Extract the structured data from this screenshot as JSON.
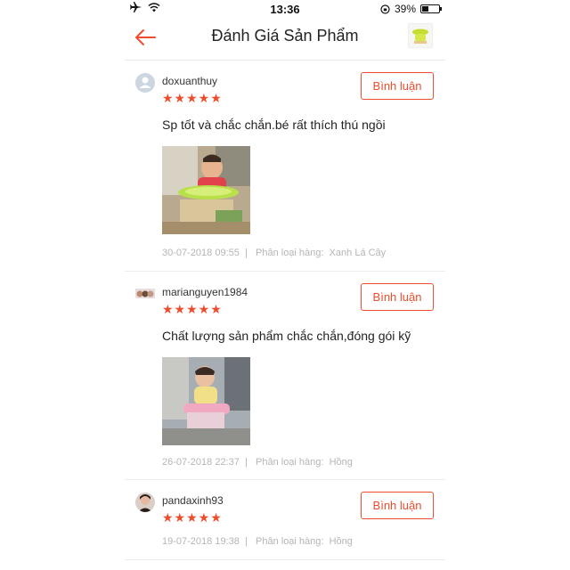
{
  "status_bar": {
    "time": "13:36",
    "battery": "39%",
    "battery_level": 0.39
  },
  "header": {
    "title": "Đánh Giá Sản Phẩm"
  },
  "reviews": [
    {
      "username": "doxuanthuy",
      "rating": 5,
      "stars": "★★★★★",
      "comment_label": "Bình luận",
      "text": "Sp tốt và chắc chắn.bé rất thích thú ngồi",
      "date": "30-07-2018 09:55",
      "variant_label": "Phân loại hàng:",
      "variant": "Xanh Lá Cây"
    },
    {
      "username": "marianguyen1984",
      "rating": 5,
      "stars": "★★★★★",
      "comment_label": "Bình luận",
      "text": "Chất lượng sản phẩm chắc chắn,đóng gói kỹ",
      "date": "26-07-2018 22:37",
      "variant_label": "Phân loại hàng:",
      "variant": "Hồng"
    },
    {
      "username": "pandaxinh93",
      "rating": 5,
      "stars": "★★★★★",
      "comment_label": "Bình luận",
      "date": "19-07-2018 19:38",
      "variant_label": "Phân loại hàng:",
      "variant": "Hồng"
    }
  ],
  "colors": {
    "accent": "#ee4d2d",
    "meta_text": "#b5b5b5",
    "divider": "#ececec"
  }
}
